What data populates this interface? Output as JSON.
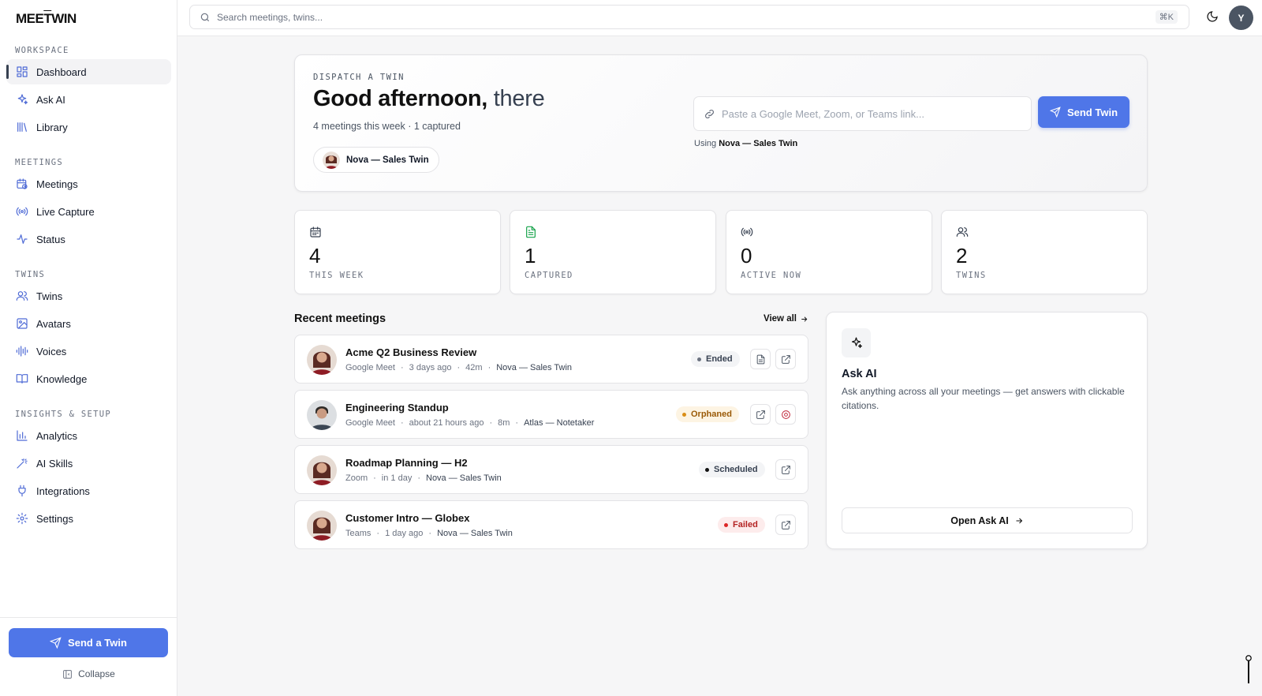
{
  "app": {
    "logo_text_1": "MEE",
    "logo_text_2": "T",
    "logo_text_3": "WIN"
  },
  "sidebar": {
    "sections": [
      {
        "label": "WORKSPACE"
      },
      {
        "label": "MEETINGS"
      },
      {
        "label": "TWINS"
      },
      {
        "label": "INSIGHTS & SETUP"
      }
    ],
    "items": [
      {
        "label": "Dashboard",
        "icon": "grid-icon",
        "active": true
      },
      {
        "label": "Ask AI",
        "icon": "sparkles-icon"
      },
      {
        "label": "Library",
        "icon": "library-icon"
      },
      {
        "label": "Meetings",
        "icon": "calendar-clock-icon"
      },
      {
        "label": "Live Capture",
        "icon": "radio-icon"
      },
      {
        "label": "Status",
        "icon": "activity-icon"
      },
      {
        "label": "Twins",
        "icon": "users-icon"
      },
      {
        "label": "Avatars",
        "icon": "image-icon"
      },
      {
        "label": "Voices",
        "icon": "audio-lines-icon"
      },
      {
        "label": "Knowledge",
        "icon": "book-open-icon"
      },
      {
        "label": "Analytics",
        "icon": "bar-chart-icon"
      },
      {
        "label": "AI Skills",
        "icon": "wand-icon"
      },
      {
        "label": "Integrations",
        "icon": "plug-icon"
      },
      {
        "label": "Settings",
        "icon": "gear-icon"
      }
    ],
    "send_button": "Send a Twin",
    "collapse_label": "Collapse"
  },
  "topbar": {
    "search_placeholder": "Search meetings, twins...",
    "shortcut": "⌘K",
    "user_initial": "Y"
  },
  "hero": {
    "eyebrow": "DISPATCH A TWIN",
    "greeting": "Good afternoon,",
    "name": "there",
    "subtitle": "4 meetings this week · 1 captured",
    "twin_chip": "Nova — Sales Twin",
    "link_placeholder": "Paste a Google Meet, Zoom, or Teams link...",
    "send_button": "Send Twin",
    "using_prefix": "Using",
    "using_twin": "Nova — Sales Twin"
  },
  "stats": [
    {
      "value": "4",
      "label": "THIS WEEK",
      "icon": "calendar-icon",
      "color": "#374151"
    },
    {
      "value": "1",
      "label": "CAPTURED",
      "icon": "file-text-icon",
      "color": "#16a34a"
    },
    {
      "value": "0",
      "label": "ACTIVE NOW",
      "icon": "radio-icon",
      "color": "#374151"
    },
    {
      "value": "2",
      "label": "TWINS",
      "icon": "users-icon",
      "color": "#374151"
    }
  ],
  "recent": {
    "title": "Recent meetings",
    "view_all": "View all",
    "meetings": [
      {
        "title": "Acme Q2 Business Review",
        "platform": "Google Meet",
        "when": "3 days ago",
        "duration": "42m",
        "twin": "Nova — Sales Twin",
        "status": "Ended"
      },
      {
        "title": "Engineering Standup",
        "platform": "Google Meet",
        "when": "about 21 hours ago",
        "duration": "8m",
        "twin": "Atlas — Notetaker",
        "status": "Orphaned"
      },
      {
        "title": "Roadmap Planning — H2",
        "platform": "Zoom",
        "when": "in 1 day",
        "twin": "Nova — Sales Twin",
        "status": "Scheduled"
      },
      {
        "title": "Customer Intro — Globex",
        "platform": "Teams",
        "when": "1 day ago",
        "twin": "Nova — Sales Twin",
        "status": "Failed"
      }
    ]
  },
  "ask_ai": {
    "title": "Ask AI",
    "description": "Ask anything across all your meetings — get answers with clickable citations.",
    "button": "Open Ask AI"
  },
  "colors": {
    "accent": "#4f76e8",
    "nav_icon": "#4f6bd6"
  }
}
